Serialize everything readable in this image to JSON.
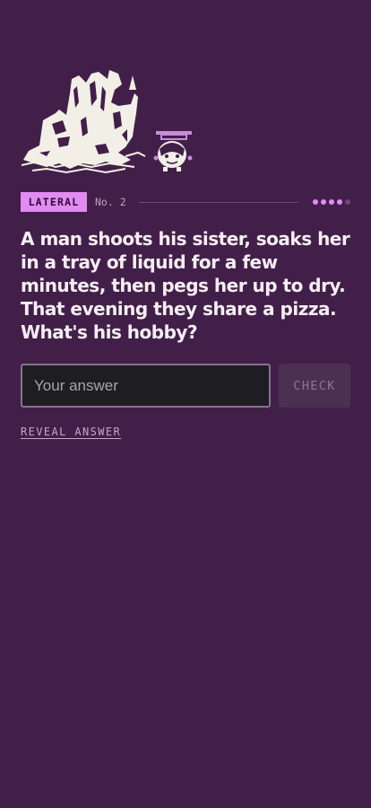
{
  "illustration": {
    "icon": "photo-developing-scene-illustration",
    "ink_color": "#f2efe6",
    "accent_color": "#c98bdc"
  },
  "puzzle": {
    "category": "LATERAL",
    "number_label": "No. 2",
    "progress": {
      "filled": 4,
      "total": 5
    },
    "question": "A man shoots his sister, soaks her in a tray of liquid for a few minutes, then pegs her up to dry. That evening they share a pizza. What's his hobby?"
  },
  "answer": {
    "placeholder": "Your answer",
    "value": "",
    "check_label": "CHECK",
    "reveal_label": "REVEAL ANSWER"
  },
  "colors": {
    "background": "#421f48",
    "accent": "#e28bf2",
    "text": "#f6eef4",
    "input_background": "#1e1e22"
  }
}
